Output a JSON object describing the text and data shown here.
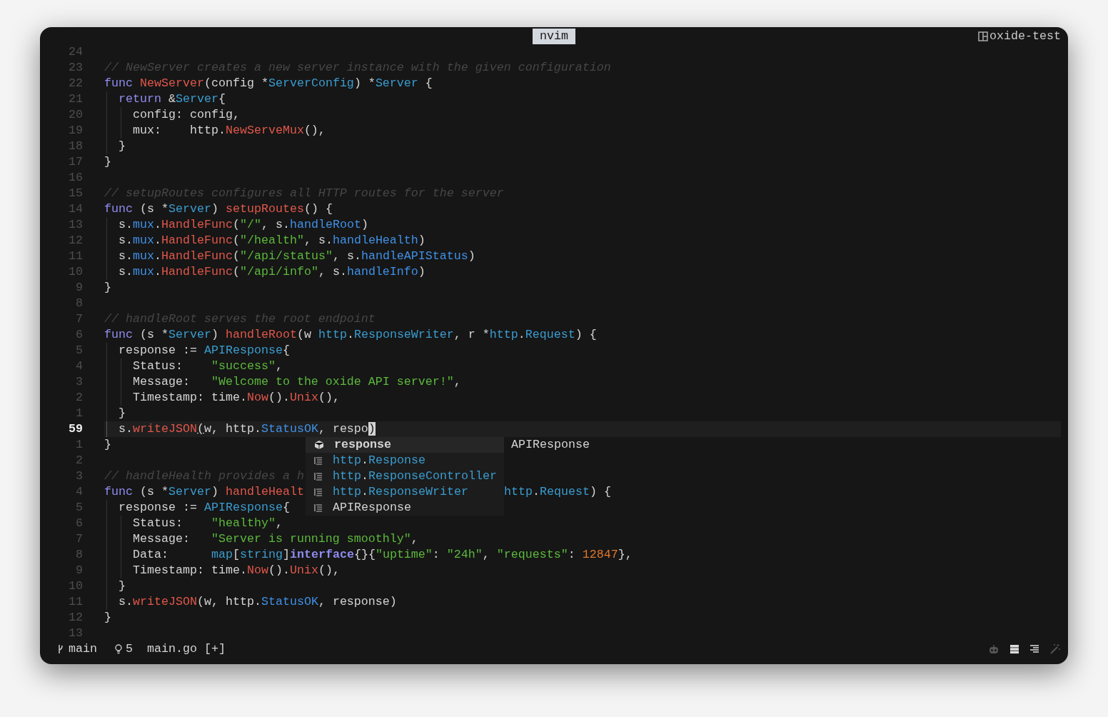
{
  "window": {
    "tab": "nvim",
    "session": "oxide-test"
  },
  "editor": {
    "lines": [
      {
        "number": "24",
        "current": false
      },
      {
        "number": "23",
        "current": false,
        "tokens": [
          {
            "kind": "comment",
            "text": "// NewServer creates a new server instance with the given configuration"
          }
        ]
      },
      {
        "number": "22",
        "current": false,
        "tokens": [
          {
            "kind": "keyword",
            "text": "func "
          },
          {
            "kind": "function",
            "text": "NewServer"
          },
          {
            "kind": "plain",
            "text": "(config *"
          },
          {
            "kind": "type",
            "text": "ServerConfig"
          },
          {
            "kind": "plain",
            "text": ") *"
          },
          {
            "kind": "type",
            "text": "Server"
          },
          {
            "kind": "plain",
            "text": " {"
          }
        ]
      },
      {
        "number": "21",
        "current": false,
        "tokens": [
          {
            "kind": "keyword",
            "text": "  return"
          },
          {
            "kind": "plain",
            "text": " &"
          },
          {
            "kind": "type",
            "text": "Server"
          },
          {
            "kind": "plain",
            "text": "{"
          }
        ]
      },
      {
        "number": "20",
        "current": false,
        "tokens": [
          {
            "kind": "plain",
            "text": "    config: config,"
          }
        ]
      },
      {
        "number": "19",
        "current": false,
        "tokens": [
          {
            "kind": "plain",
            "text": "    mux:    http."
          },
          {
            "kind": "function",
            "text": "NewServeMux"
          },
          {
            "kind": "plain",
            "text": "(),"
          }
        ]
      },
      {
        "number": "18",
        "current": false,
        "tokens": [
          {
            "kind": "plain",
            "text": "  }"
          }
        ]
      },
      {
        "number": "17",
        "current": false,
        "tokens": [
          {
            "kind": "plain",
            "text": "}"
          }
        ]
      },
      {
        "number": "16",
        "current": false
      },
      {
        "number": "15",
        "current": false,
        "tokens": [
          {
            "kind": "comment",
            "text": "// setupRoutes configures all HTTP routes for the server"
          }
        ]
      },
      {
        "number": "14",
        "current": false,
        "tokens": [
          {
            "kind": "keyword",
            "text": "func"
          },
          {
            "kind": "plain",
            "text": " (s *"
          },
          {
            "kind": "type",
            "text": "Server"
          },
          {
            "kind": "plain",
            "text": ") "
          },
          {
            "kind": "function",
            "text": "setupRoutes"
          },
          {
            "kind": "plain",
            "text": "() {"
          }
        ]
      },
      {
        "number": "13",
        "current": false,
        "tokens": [
          {
            "kind": "plain",
            "text": "  s."
          },
          {
            "kind": "member",
            "text": "mux"
          },
          {
            "kind": "plain",
            "text": "."
          },
          {
            "kind": "function",
            "text": "HandleFunc"
          },
          {
            "kind": "plain",
            "text": "("
          },
          {
            "kind": "string",
            "text": "\"/\""
          },
          {
            "kind": "plain",
            "text": ", s."
          },
          {
            "kind": "member",
            "text": "handleRoot"
          },
          {
            "kind": "plain",
            "text": ")"
          }
        ]
      },
      {
        "number": "12",
        "current": false,
        "tokens": [
          {
            "kind": "plain",
            "text": "  s."
          },
          {
            "kind": "member",
            "text": "mux"
          },
          {
            "kind": "plain",
            "text": "."
          },
          {
            "kind": "function",
            "text": "HandleFunc"
          },
          {
            "kind": "plain",
            "text": "("
          },
          {
            "kind": "string",
            "text": "\"/health\""
          },
          {
            "kind": "plain",
            "text": ", s."
          },
          {
            "kind": "member",
            "text": "handleHealth"
          },
          {
            "kind": "plain",
            "text": ")"
          }
        ]
      },
      {
        "number": "11",
        "current": false,
        "tokens": [
          {
            "kind": "plain",
            "text": "  s."
          },
          {
            "kind": "member",
            "text": "mux"
          },
          {
            "kind": "plain",
            "text": "."
          },
          {
            "kind": "function",
            "text": "HandleFunc"
          },
          {
            "kind": "plain",
            "text": "("
          },
          {
            "kind": "string",
            "text": "\"/api/status\""
          },
          {
            "kind": "plain",
            "text": ", s."
          },
          {
            "kind": "member",
            "text": "handleAPIStatus"
          },
          {
            "kind": "plain",
            "text": ")"
          }
        ]
      },
      {
        "number": "10",
        "current": false,
        "tokens": [
          {
            "kind": "plain",
            "text": "  s."
          },
          {
            "kind": "member",
            "text": "mux"
          },
          {
            "kind": "plain",
            "text": "."
          },
          {
            "kind": "function",
            "text": "HandleFunc"
          },
          {
            "kind": "plain",
            "text": "("
          },
          {
            "kind": "string",
            "text": "\"/api/info\""
          },
          {
            "kind": "plain",
            "text": ", s."
          },
          {
            "kind": "member",
            "text": "handleInfo"
          },
          {
            "kind": "plain",
            "text": ")"
          }
        ]
      },
      {
        "number": "9",
        "current": false,
        "tokens": [
          {
            "kind": "plain",
            "text": "}"
          }
        ]
      },
      {
        "number": "8",
        "current": false
      },
      {
        "number": "7",
        "current": false,
        "tokens": [
          {
            "kind": "comment",
            "text": "// handleRoot serves the root endpoint"
          }
        ]
      },
      {
        "number": "6",
        "current": false,
        "tokens": [
          {
            "kind": "keyword",
            "text": "func"
          },
          {
            "kind": "plain",
            "text": " (s *"
          },
          {
            "kind": "type",
            "text": "Server"
          },
          {
            "kind": "plain",
            "text": ") "
          },
          {
            "kind": "function",
            "text": "handleRoot"
          },
          {
            "kind": "plain",
            "text": "(w "
          },
          {
            "kind": "type",
            "text": "http"
          },
          {
            "kind": "plain",
            "text": "."
          },
          {
            "kind": "type",
            "text": "ResponseWriter"
          },
          {
            "kind": "plain",
            "text": ", r *"
          },
          {
            "kind": "type",
            "text": "http"
          },
          {
            "kind": "plain",
            "text": "."
          },
          {
            "kind": "type",
            "text": "Request"
          },
          {
            "kind": "plain",
            "text": ") {"
          }
        ]
      },
      {
        "number": "5",
        "current": false,
        "tokens": [
          {
            "kind": "plain",
            "text": "  response := "
          },
          {
            "kind": "type",
            "text": "APIResponse"
          },
          {
            "kind": "plain",
            "text": "{"
          }
        ]
      },
      {
        "number": "4",
        "current": false,
        "tokens": [
          {
            "kind": "plain",
            "text": "    Status:    "
          },
          {
            "kind": "string",
            "text": "\"success\""
          },
          {
            "kind": "plain",
            "text": ","
          }
        ]
      },
      {
        "number": "3",
        "current": false,
        "tokens": [
          {
            "kind": "plain",
            "text": "    Message:   "
          },
          {
            "kind": "string",
            "text": "\"Welcome to the oxide API server!\""
          },
          {
            "kind": "plain",
            "text": ","
          }
        ]
      },
      {
        "number": "2",
        "current": false,
        "tokens": [
          {
            "kind": "plain",
            "text": "    Timestamp: time."
          },
          {
            "kind": "function",
            "text": "Now"
          },
          {
            "kind": "plain",
            "text": "()."
          },
          {
            "kind": "function",
            "text": "Unix"
          },
          {
            "kind": "plain",
            "text": "(),"
          }
        ]
      },
      {
        "number": "1",
        "current": false,
        "tokens": [
          {
            "kind": "plain",
            "text": "  }"
          }
        ]
      },
      {
        "number": "59",
        "current": true,
        "tokens": [
          {
            "kind": "plain",
            "text": "  s."
          },
          {
            "kind": "function",
            "text": "writeJSON"
          },
          {
            "kind": "match",
            "text": "("
          },
          {
            "kind": "plain",
            "text": "w, http."
          },
          {
            "kind": "member",
            "text": "StatusOK"
          },
          {
            "kind": "plain",
            "text": ", respo"
          },
          {
            "kind": "cursor",
            "text": ")"
          }
        ]
      },
      {
        "number": "1",
        "current": false,
        "tokens": [
          {
            "kind": "plain",
            "text": "}"
          }
        ]
      },
      {
        "number": "2",
        "current": false
      },
      {
        "number": "3",
        "current": false,
        "tokens": [
          {
            "kind": "comment",
            "text": "// handleHealth provides a h"
          }
        ]
      },
      {
        "number": "4",
        "current": false,
        "tokens": [
          {
            "kind": "keyword",
            "text": "func"
          },
          {
            "kind": "plain",
            "text": " (s *"
          },
          {
            "kind": "type",
            "text": "Server"
          },
          {
            "kind": "plain",
            "text": ") "
          },
          {
            "kind": "function",
            "text": "handleHealt"
          }
        ],
        "after_popup": [
          {
            "kind": "type",
            "text": "http"
          },
          {
            "kind": "plain",
            "text": "."
          },
          {
            "kind": "type",
            "text": "Request"
          },
          {
            "kind": "plain",
            "text": ") {"
          }
        ]
      },
      {
        "number": "5",
        "current": false,
        "tokens": [
          {
            "kind": "plain",
            "text": "  response := "
          },
          {
            "kind": "type",
            "text": "APIResponse"
          },
          {
            "kind": "plain",
            "text": "{"
          }
        ]
      },
      {
        "number": "6",
        "current": false,
        "tokens": [
          {
            "kind": "plain",
            "text": "    Status:    "
          },
          {
            "kind": "string",
            "text": "\"healthy\""
          },
          {
            "kind": "plain",
            "text": ","
          }
        ]
      },
      {
        "number": "7",
        "current": false,
        "tokens": [
          {
            "kind": "plain",
            "text": "    Message:   "
          },
          {
            "kind": "string",
            "text": "\"Server is running smoothly\""
          },
          {
            "kind": "plain",
            "text": ","
          }
        ]
      },
      {
        "number": "8",
        "current": false,
        "tokens": [
          {
            "kind": "plain",
            "text": "    Data:      "
          },
          {
            "kind": "type",
            "text": "map"
          },
          {
            "kind": "plain",
            "text": "["
          },
          {
            "kind": "type",
            "text": "string"
          },
          {
            "kind": "plain",
            "text": "]"
          },
          {
            "kind": "keyword-bold",
            "text": "interface"
          },
          {
            "kind": "plain",
            "text": "{}{"
          },
          {
            "kind": "string",
            "text": "\"uptime\""
          },
          {
            "kind": "plain",
            "text": ": "
          },
          {
            "kind": "string",
            "text": "\"24h\""
          },
          {
            "kind": "plain",
            "text": ", "
          },
          {
            "kind": "string",
            "text": "\"requests\""
          },
          {
            "kind": "plain",
            "text": ": "
          },
          {
            "kind": "number",
            "text": "12847"
          },
          {
            "kind": "plain",
            "text": "},"
          }
        ]
      },
      {
        "number": "9",
        "current": false,
        "tokens": [
          {
            "kind": "plain",
            "text": "    Timestamp: time."
          },
          {
            "kind": "function",
            "text": "Now"
          },
          {
            "kind": "plain",
            "text": "()."
          },
          {
            "kind": "function",
            "text": "Unix"
          },
          {
            "kind": "plain",
            "text": "(),"
          }
        ]
      },
      {
        "number": "10",
        "current": false,
        "tokens": [
          {
            "kind": "plain",
            "text": "  }"
          }
        ]
      },
      {
        "number": "11",
        "current": false,
        "tokens": [
          {
            "kind": "plain",
            "text": "  s."
          },
          {
            "kind": "function",
            "text": "writeJSON"
          },
          {
            "kind": "plain",
            "text": "(w, http."
          },
          {
            "kind": "member",
            "text": "StatusOK"
          },
          {
            "kind": "plain",
            "text": ", response)"
          }
        ]
      },
      {
        "number": "12",
        "current": false,
        "tokens": [
          {
            "kind": "plain",
            "text": "}"
          }
        ]
      },
      {
        "number": "13",
        "current": false
      }
    ]
  },
  "completion": {
    "detail": "APIResponse",
    "items": [
      {
        "kind": "variable",
        "selected": true,
        "parts": [
          {
            "kind": "plain",
            "text": "response"
          }
        ]
      },
      {
        "kind": "struct",
        "selected": false,
        "parts": [
          {
            "kind": "type",
            "text": "http"
          },
          {
            "kind": "plain",
            "text": "."
          },
          {
            "kind": "type",
            "text": "Response"
          }
        ]
      },
      {
        "kind": "struct",
        "selected": false,
        "parts": [
          {
            "kind": "type",
            "text": "http"
          },
          {
            "kind": "plain",
            "text": "."
          },
          {
            "kind": "type",
            "text": "ResponseController"
          }
        ]
      },
      {
        "kind": "struct",
        "selected": false,
        "parts": [
          {
            "kind": "type",
            "text": "http"
          },
          {
            "kind": "plain",
            "text": "."
          },
          {
            "kind": "type",
            "text": "ResponseWriter"
          }
        ]
      },
      {
        "kind": "struct",
        "selected": false,
        "parts": [
          {
            "kind": "plain",
            "text": "APIResponse"
          }
        ]
      }
    ]
  },
  "status_bar": {
    "branch": "main",
    "hints": "5",
    "file": "main.go [+]"
  }
}
